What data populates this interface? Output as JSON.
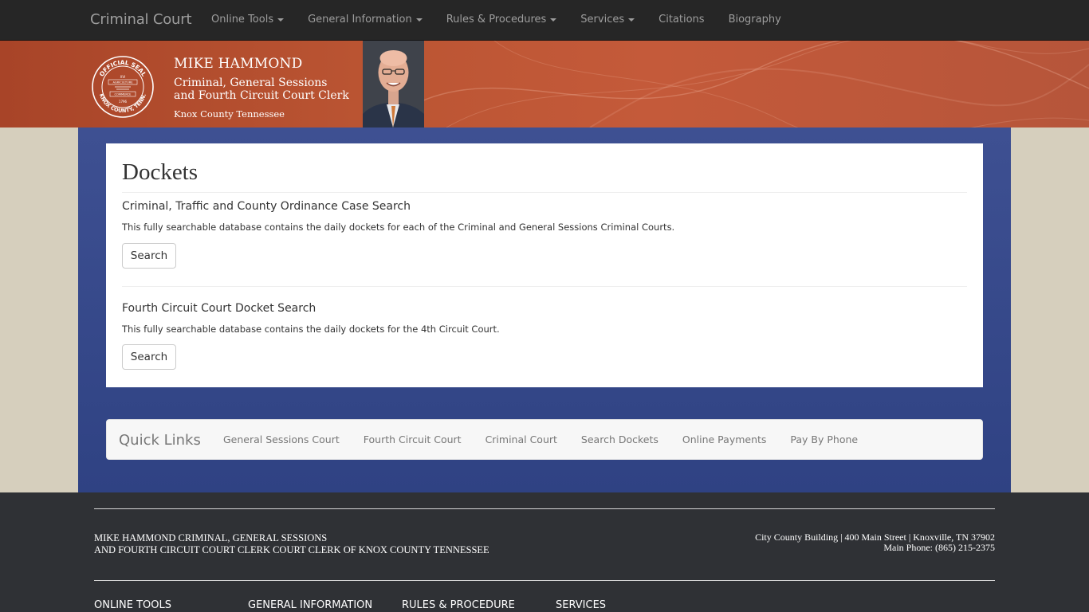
{
  "navbar": {
    "brand": "Criminal Court",
    "items": [
      {
        "label": "Online Tools",
        "dropdown": true
      },
      {
        "label": "General Information",
        "dropdown": true
      },
      {
        "label": "Rules & Procedures",
        "dropdown": true
      },
      {
        "label": "Services",
        "dropdown": true
      },
      {
        "label": "Citations",
        "dropdown": false
      },
      {
        "label": "Biography",
        "dropdown": false
      }
    ]
  },
  "header": {
    "name": "MIKE HAMMOND",
    "title_line1": "Criminal, General Sessions",
    "title_line2": "and Fourth Circuit Court Clerk",
    "county": "Knox County Tennessee",
    "seal_top": "OFFICIAL SEAL",
    "seal_bottom": "KNOX COUNTY, TENN.",
    "seal_band1": "AGRICULTURE",
    "seal_band2": "COMMERCE",
    "seal_year": "1796",
    "seal_roman": "XVI"
  },
  "main": {
    "page_title": "Dockets",
    "sections": [
      {
        "title": "Criminal, Traffic and County Ordinance Case Search",
        "description": "This fully searchable database contains the daily dockets for each of the Criminal and General Sessions Criminal Courts.",
        "button": "Search"
      },
      {
        "title": "Fourth Circuit Court Docket Search",
        "description": "This fully searchable database contains the daily dockets for the 4th Circuit Court.",
        "button": "Search"
      }
    ]
  },
  "quick_links": {
    "brand": "Quick Links",
    "items": [
      "General Sessions Court",
      "Fourth Circuit Court",
      "Criminal Court",
      "Search Dockets",
      "Online Payments",
      "Pay By Phone"
    ]
  },
  "footer": {
    "left_line1": "MIKE HAMMOND CRIMINAL, GENERAL SESSIONS",
    "left_line2": "AND FOURTH CIRCUIT COURT CLERK COURT CLERK OF KNOX COUNTY TENNESSEE",
    "address": "City County Building | 400 Main Street | Knoxville, TN 37902",
    "phone": "Main Phone: (865) 215-2375",
    "columns": [
      "ONLINE TOOLS",
      "GENERAL INFORMATION",
      "RULES & PROCEDURE",
      "SERVICES"
    ]
  },
  "colors": {
    "navbar_bg": "#262626",
    "banner": "#bb5533",
    "main_bg": "#364a8b",
    "footer_bg": "#2f3135",
    "page_bg": "#d6cfbd"
  }
}
